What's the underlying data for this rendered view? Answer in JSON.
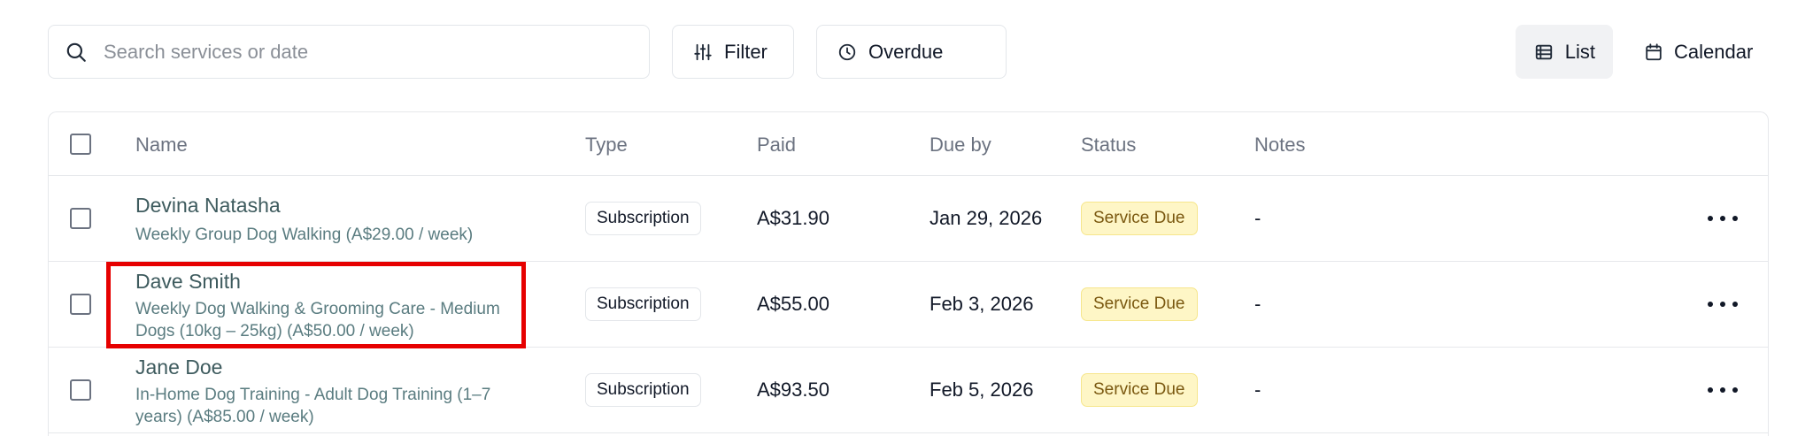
{
  "search": {
    "placeholder": "Search services or date",
    "value": ""
  },
  "toolbar": {
    "filter_label": "Filter",
    "overdue_label": "Overdue"
  },
  "views": {
    "list_label": "List",
    "calendar_label": "Calendar"
  },
  "table": {
    "columns": [
      "Name",
      "Type",
      "Paid",
      "Due by",
      "Status",
      "Notes"
    ],
    "rows": [
      {
        "name": "Devina Natasha",
        "subtitle": [
          "Weekly Group Dog Walking (A$29.00 / week)"
        ],
        "type": "Subscription",
        "paid": "A$31.90",
        "due": "Jan 29, 2026",
        "status": "Service Due",
        "notes": "-"
      },
      {
        "name": "Dave Smith",
        "subtitle": [
          "Weekly Dog Walking & Grooming Care - Medium",
          "Dogs (10kg – 25kg) (A$50.00 / week)"
        ],
        "type": "Subscription",
        "paid": "A$55.00",
        "due": "Feb 3, 2026",
        "status": "Service Due",
        "notes": "-"
      },
      {
        "name": "Jane Doe",
        "subtitle": [
          "In-Home Dog Training - Adult Dog Training (1–7",
          "years) (A$85.00 / week)"
        ],
        "type": "Subscription",
        "paid": "A$93.50",
        "due": "Feb 5, 2026",
        "status": "Service Due",
        "notes": "-"
      }
    ]
  },
  "colors": {
    "accent_text": "#3e5b5e",
    "status_bg": "#fef6c6",
    "status_text": "#7a5810",
    "highlight": "#e60000"
  },
  "icons": [
    "search-icon",
    "filter-sliders-icon",
    "clock-icon",
    "list-icon",
    "calendar-icon",
    "more-horizontal-icon"
  ]
}
